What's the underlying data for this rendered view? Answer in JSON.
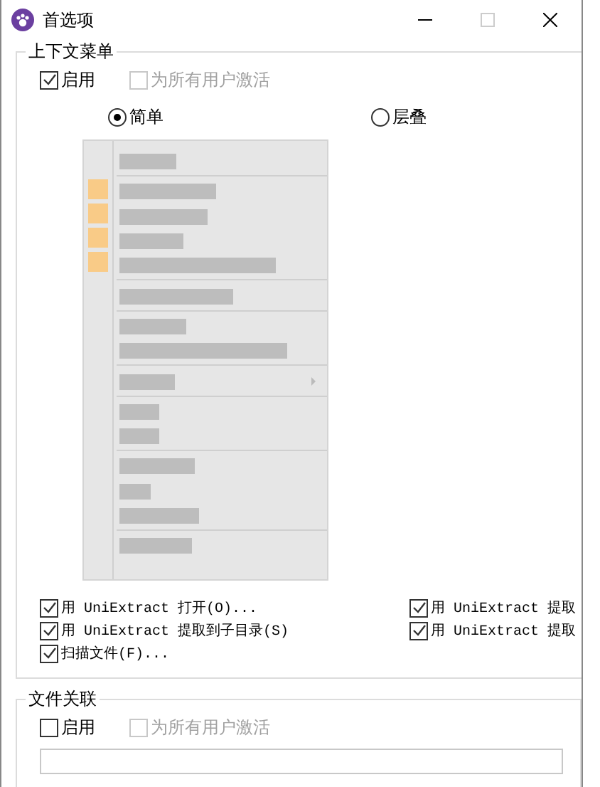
{
  "window": {
    "title": "首选项",
    "maximize_disabled": true
  },
  "context_menu": {
    "title": "上下文菜单",
    "enable": {
      "label": "启用",
      "checked": true,
      "disabled": false
    },
    "all_users": {
      "label": "为所有用户激活",
      "checked": false,
      "disabled": true
    },
    "styles": [
      {
        "label": "简单",
        "selected": true
      },
      {
        "label": "层叠",
        "selected": false
      }
    ],
    "items": [
      {
        "label": "用 UniExtract 打开(O)...",
        "checked": true
      },
      {
        "label": "用 UniExtract 提取",
        "checked": true
      },
      {
        "label": "用 UniExtract 提取到子目录(S)",
        "checked": true
      },
      {
        "label": "用 UniExtract 提取",
        "checked": true
      },
      {
        "label": "扫描文件(F)...",
        "checked": true
      }
    ]
  },
  "file_association": {
    "title": "文件关联",
    "enable": {
      "label": "启用",
      "checked": false,
      "disabled": false
    },
    "all_users": {
      "label": "为所有用户激活",
      "checked": false,
      "disabled": true
    }
  }
}
